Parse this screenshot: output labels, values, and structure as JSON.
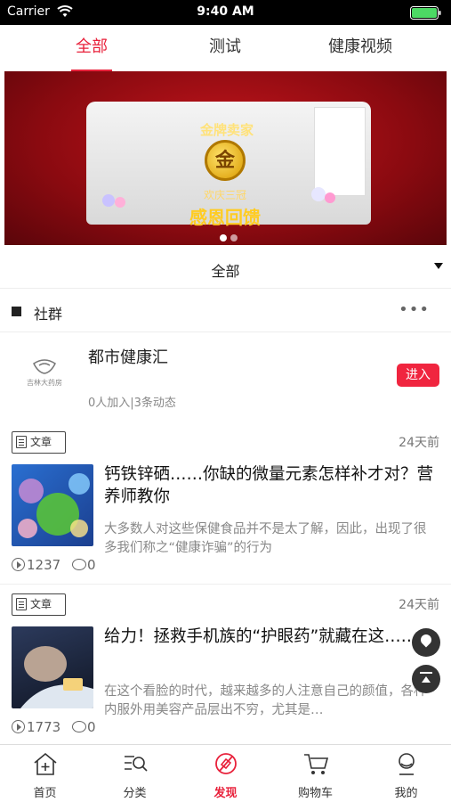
{
  "status_bar": {
    "carrier": "Carrier",
    "time": "9:40 AM"
  },
  "top_tabs": [
    {
      "label": "全部",
      "active": true
    },
    {
      "label": "测试",
      "active": false
    },
    {
      "label": "健康视频",
      "active": false
    }
  ],
  "banner": {
    "title": "金牌卖家",
    "coin": "金",
    "subtitle": "欢庆三冠",
    "headline": "感恩回馈"
  },
  "filter": {
    "label": "全部"
  },
  "section": {
    "title": "社群",
    "more": "•••"
  },
  "community": {
    "logo_text": "吉林大药房",
    "name": "都市健康汇",
    "stats": "0人加入|3条动态",
    "enter_label": "进入"
  },
  "articles": [
    {
      "tag": "文章",
      "time": "24天前",
      "title": "钙铁锌硒……你缺的微量元素怎样补才对？营养师教你",
      "summary": "大多数人对这些保健食品并不是太了解，因此，出现了很多我们称之“健康诈骗”的行为",
      "views": "1237",
      "comments": "0"
    },
    {
      "tag": "文章",
      "time": "24天前",
      "title": "给力！拯救手机族的“护眼药”就藏在这……",
      "summary": "在这个看脸的时代，越来越多的人注意自己的颜值，各种内服外用美容产品层出不穷，尤其是…",
      "views": "1773",
      "comments": "0"
    }
  ],
  "bottom_tabs": [
    {
      "label": "首页",
      "icon": "home-icon"
    },
    {
      "label": "分类",
      "icon": "category-search-icon"
    },
    {
      "label": "发现",
      "icon": "discover-icon",
      "active": true
    },
    {
      "label": "购物车",
      "icon": "cart-icon"
    },
    {
      "label": "我的",
      "icon": "profile-icon"
    }
  ],
  "colors": {
    "accent": "#e8213b",
    "enter_button": "#f0253f"
  }
}
